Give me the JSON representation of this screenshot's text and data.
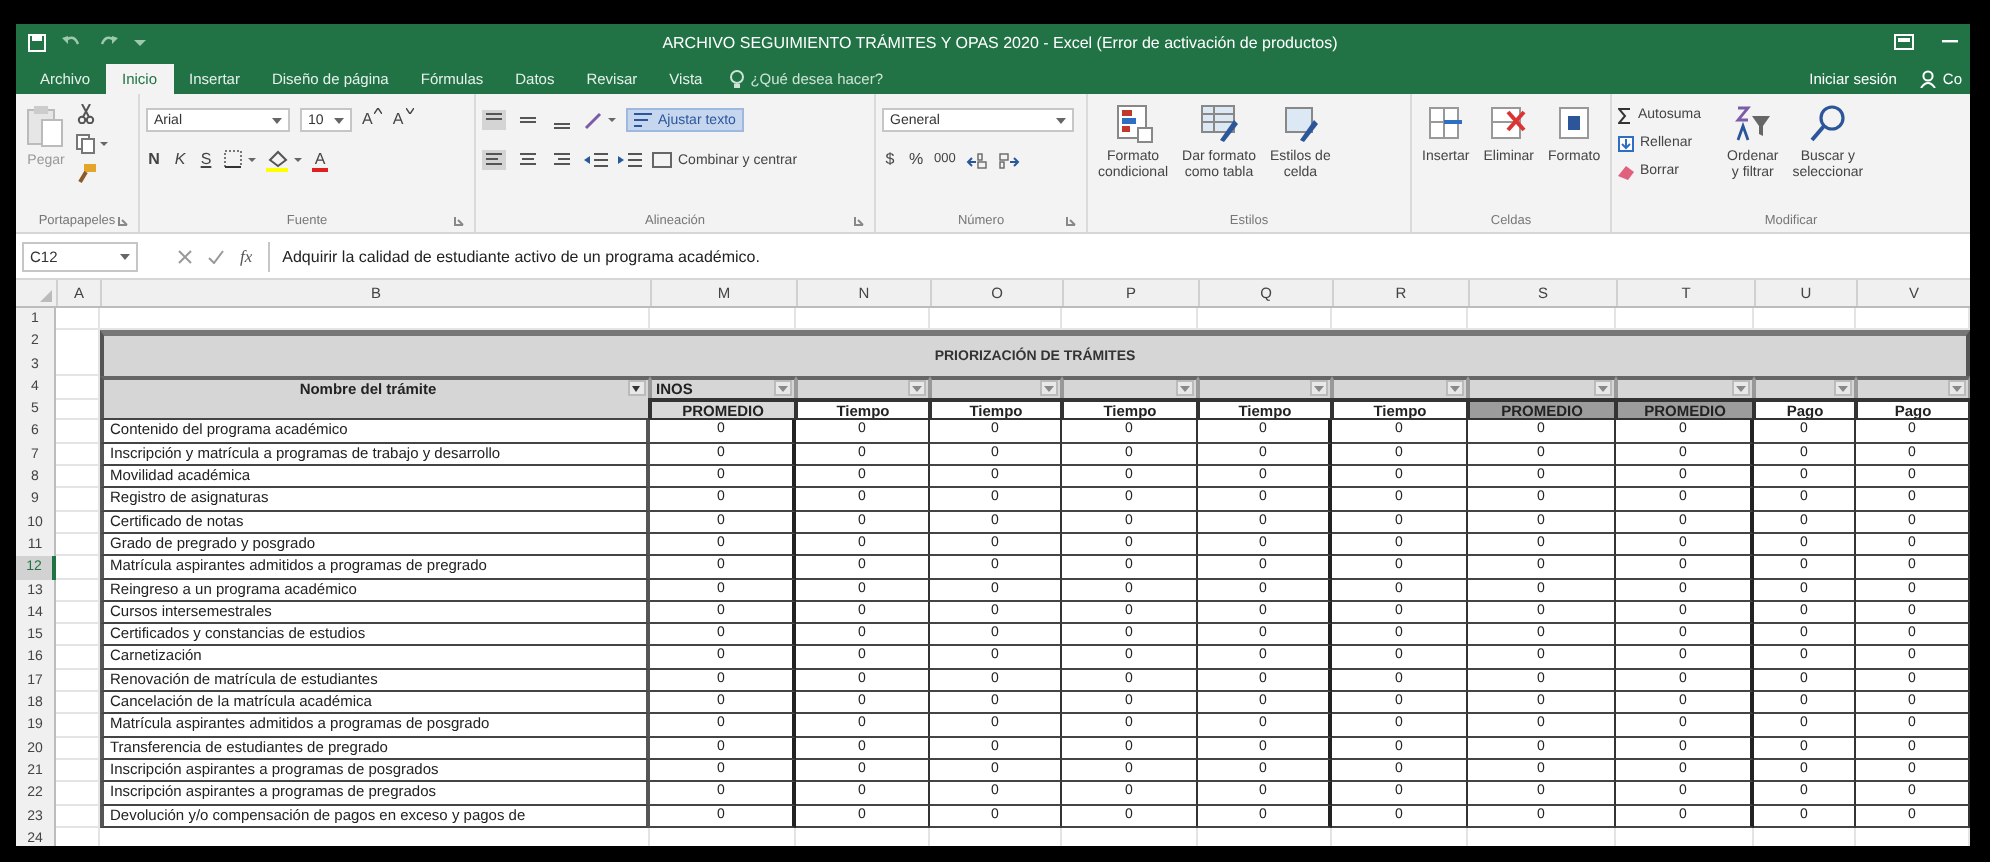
{
  "window": {
    "title": "ARCHIVO SEGUIMIENTO TRÁMITES Y OPAS 2020 - Excel (Error de activación de productos)"
  },
  "ribbon_tabs": [
    {
      "label": "Archivo",
      "selected": false
    },
    {
      "label": "Inicio",
      "selected": true
    },
    {
      "label": "Insertar",
      "selected": false
    },
    {
      "label": "Diseño de página",
      "selected": false
    },
    {
      "label": "Fórmulas",
      "selected": false
    },
    {
      "label": "Datos",
      "selected": false
    },
    {
      "label": "Revisar",
      "selected": false
    },
    {
      "label": "Vista",
      "selected": false
    }
  ],
  "tell_me": {
    "placeholder": "¿Qué desea hacer?"
  },
  "account": {
    "sign_in": "Iniciar sesión",
    "share": "Co"
  },
  "ribbon": {
    "clipboard": {
      "label": "Portapapeles",
      "paste": "Pegar"
    },
    "font": {
      "label": "Fuente",
      "name": "Arial",
      "size": "10",
      "grow": "A",
      "shrink": "A",
      "bold": "N",
      "italic": "K",
      "underline": "S",
      "font_color": "A"
    },
    "alignment": {
      "label": "Alineación",
      "wrap": "Ajustar texto",
      "wrap_on": true,
      "merge": "Combinar y centrar"
    },
    "number": {
      "label": "Número",
      "format": "General",
      "currency": "$",
      "percent": "%",
      "thousands": "000"
    },
    "styles": {
      "label": "Estilos",
      "buttons": [
        {
          "lines": [
            "Formato",
            "condicional"
          ],
          "kind": "conditional"
        },
        {
          "lines": [
            "Dar formato",
            "como tabla"
          ],
          "kind": "table"
        },
        {
          "lines": [
            "Estilos de",
            "celda"
          ],
          "kind": "cellstyle"
        }
      ]
    },
    "cells": {
      "label": "Celdas",
      "buttons": [
        {
          "lines": [
            "Insertar"
          ],
          "kind": "insert"
        },
        {
          "lines": [
            "Eliminar"
          ],
          "kind": "delete"
        },
        {
          "lines": [
            "Formato"
          ],
          "kind": "format"
        }
      ]
    },
    "editing": {
      "label": "Modificar",
      "autosum": "Autosuma",
      "fill": "Rellenar",
      "clear": "Borrar",
      "sort": [
        "Ordenar",
        "y filtrar"
      ],
      "find": [
        "Buscar y",
        "seleccionar"
      ]
    }
  },
  "formula_bar": {
    "name_box": "C12",
    "fx": "fx",
    "formula": "Adquirir la calidad de estudiante activo de un programa académico."
  },
  "sheet": {
    "columns": [
      "A",
      "B",
      "M",
      "N",
      "O",
      "P",
      "Q",
      "R",
      "S",
      "T",
      "U",
      "V"
    ],
    "row_numbers": [
      {
        "label": "1",
        "selected": false
      },
      {
        "label": "2",
        "selected": false
      },
      {
        "label": "3",
        "selected": false
      },
      {
        "label": "4",
        "selected": false
      },
      {
        "label": "5",
        "selected": false
      },
      {
        "label": "6",
        "selected": false
      },
      {
        "label": "7",
        "selected": false
      },
      {
        "label": "8",
        "selected": false
      },
      {
        "label": "9",
        "selected": false
      },
      {
        "label": "10",
        "selected": false
      },
      {
        "label": "11",
        "selected": false
      },
      {
        "label": "12",
        "selected": true
      },
      {
        "label": "13",
        "selected": false
      },
      {
        "label": "14",
        "selected": false
      },
      {
        "label": "15",
        "selected": false
      },
      {
        "label": "16",
        "selected": false
      },
      {
        "label": "17",
        "selected": false
      },
      {
        "label": "18",
        "selected": false
      },
      {
        "label": "19",
        "selected": false
      },
      {
        "label": "20",
        "selected": false
      },
      {
        "label": "21",
        "selected": false
      },
      {
        "label": "22",
        "selected": false
      },
      {
        "label": "23",
        "selected": false
      },
      {
        "label": "24",
        "selected": false
      }
    ],
    "table": {
      "title": "PRIORIZACIÓN DE TRÁMITES",
      "name_header": "Nombre del trámite",
      "first_filter": "INOS",
      "headers": [
        {
          "label": "PROMEDIO",
          "color": "#d9d9d9"
        },
        {
          "label": "Tiempo",
          "color": "#ffffff"
        },
        {
          "label": "Tiempo",
          "color": "#ffffff"
        },
        {
          "label": "Tiempo",
          "color": "#ffffff"
        },
        {
          "label": "Tiempo",
          "color": "#ffffff"
        },
        {
          "label": "Tiempo",
          "color": "#ffffff"
        },
        {
          "label": "PROMEDIO",
          "color": "#9c9c9c"
        },
        {
          "label": "PROMEDIO",
          "color": "#9c9c9c"
        },
        {
          "label": "Pago",
          "color": "#ffffff"
        },
        {
          "label": "Pago",
          "color": "#ffffff"
        }
      ],
      "rows": [
        {
          "name": "Contenido del programa académico",
          "values": [
            "0",
            "0",
            "0",
            "0",
            "0",
            "0",
            "0",
            "0",
            "0",
            "0"
          ]
        },
        {
          "name": "Inscripción y matrícula a programas de trabajo y desarrollo",
          "values": [
            "0",
            "0",
            "0",
            "0",
            "0",
            "0",
            "0",
            "0",
            "0",
            "0"
          ]
        },
        {
          "name": "Movilidad académica",
          "values": [
            "0",
            "0",
            "0",
            "0",
            "0",
            "0",
            "0",
            "0",
            "0",
            "0"
          ]
        },
        {
          "name": "Registro de asignaturas",
          "values": [
            "0",
            "0",
            "0",
            "0",
            "0",
            "0",
            "0",
            "0",
            "0",
            "0"
          ]
        },
        {
          "name": "Certificado de notas",
          "values": [
            "0",
            "0",
            "0",
            "0",
            "0",
            "0",
            "0",
            "0",
            "0",
            "0"
          ]
        },
        {
          "name": "Grado de pregrado y posgrado",
          "values": [
            "0",
            "0",
            "0",
            "0",
            "0",
            "0",
            "0",
            "0",
            "0",
            "0"
          ]
        },
        {
          "name": "Matrícula aspirantes admitidos a programas de pregrado",
          "values": [
            "0",
            "0",
            "0",
            "0",
            "0",
            "0",
            "0",
            "0",
            "0",
            "0"
          ]
        },
        {
          "name": "Reingreso a un programa académico",
          "values": [
            "0",
            "0",
            "0",
            "0",
            "0",
            "0",
            "0",
            "0",
            "0",
            "0"
          ]
        },
        {
          "name": "Cursos intersemestrales",
          "values": [
            "0",
            "0",
            "0",
            "0",
            "0",
            "0",
            "0",
            "0",
            "0",
            "0"
          ]
        },
        {
          "name": "Certificados y constancias de estudios",
          "values": [
            "0",
            "0",
            "0",
            "0",
            "0",
            "0",
            "0",
            "0",
            "0",
            "0"
          ]
        },
        {
          "name": "Carnetización",
          "values": [
            "0",
            "0",
            "0",
            "0",
            "0",
            "0",
            "0",
            "0",
            "0",
            "0"
          ]
        },
        {
          "name": "Renovación de matrícula de estudiantes",
          "values": [
            "0",
            "0",
            "0",
            "0",
            "0",
            "0",
            "0",
            "0",
            "0",
            "0"
          ]
        },
        {
          "name": "Cancelación de la matrícula académica",
          "values": [
            "0",
            "0",
            "0",
            "0",
            "0",
            "0",
            "0",
            "0",
            "0",
            "0"
          ]
        },
        {
          "name": "Matrícula aspirantes admitidos a programas de posgrado",
          "values": [
            "0",
            "0",
            "0",
            "0",
            "0",
            "0",
            "0",
            "0",
            "0",
            "0"
          ]
        },
        {
          "name": "Transferencia de estudiantes de pregrado",
          "values": [
            "0",
            "0",
            "0",
            "0",
            "0",
            "0",
            "0",
            "0",
            "0",
            "0"
          ]
        },
        {
          "name": "Inscripción aspirantes a programas de posgrados",
          "values": [
            "0",
            "0",
            "0",
            "0",
            "0",
            "0",
            "0",
            "0",
            "0",
            "0"
          ]
        },
        {
          "name": "Inscripción aspirantes a programas de pregrados",
          "values": [
            "0",
            "0",
            "0",
            "0",
            "0",
            "0",
            "0",
            "0",
            "0",
            "0"
          ]
        },
        {
          "name": "Devolución y/o compensación de pagos en exceso y pagos de",
          "values": [
            "0",
            "0",
            "0",
            "0",
            "0",
            "0",
            "0",
            "0",
            "0",
            "0"
          ]
        }
      ]
    }
  }
}
